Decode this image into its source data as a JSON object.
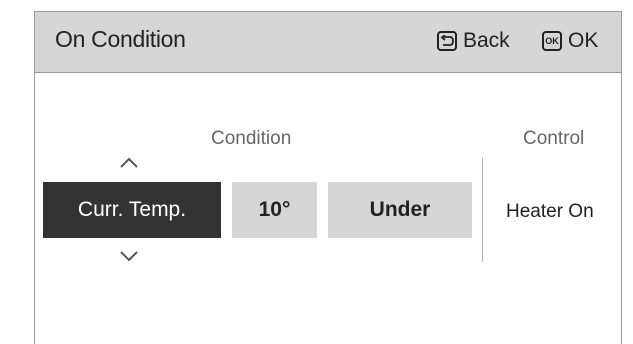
{
  "header": {
    "title": "On Condition",
    "back_label": "Back",
    "ok_label": "OK",
    "ok_icon_text": "OK"
  },
  "labels": {
    "condition": "Condition",
    "control": "Control"
  },
  "condition": {
    "target": "Curr. Temp.",
    "temperature": "10°",
    "comparison": "Under"
  },
  "control": {
    "value": "Heater On"
  },
  "icons": {
    "back": "back-return-icon",
    "ok": "ok-icon",
    "up": "chevron-up-icon",
    "down": "chevron-down-icon"
  },
  "colors": {
    "header_bg": "#d6d6d6",
    "selected_bg": "#333333",
    "cell_bg": "#d6d6d6",
    "label_gray": "#666666"
  }
}
